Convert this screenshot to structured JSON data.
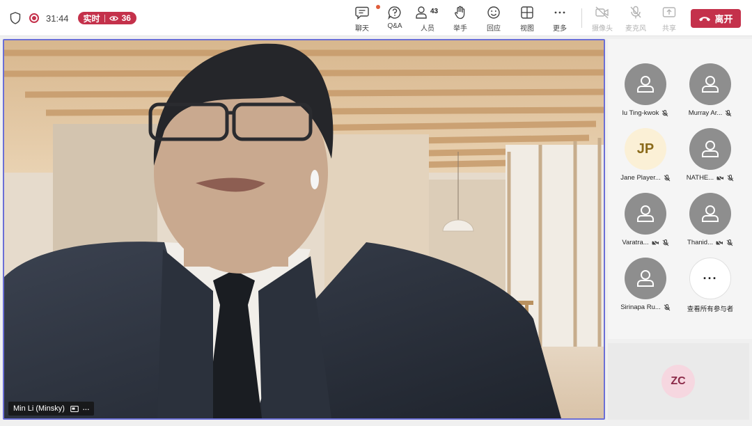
{
  "status": {
    "timer": "31:44",
    "live_label": "实时",
    "viewer_count": "36"
  },
  "toolbar": [
    {
      "id": "chat",
      "label": "聊天",
      "icon": "chat-icon"
    },
    {
      "id": "qa",
      "label": "Q&A",
      "icon": "qa-icon"
    },
    {
      "id": "people",
      "label": "人员",
      "icon": "people-icon",
      "count": "43"
    },
    {
      "id": "raise",
      "label": "举手",
      "icon": "raise-hand-icon"
    },
    {
      "id": "react",
      "label": "回应",
      "icon": "reaction-icon"
    },
    {
      "id": "view",
      "label": "视图",
      "icon": "view-grid-icon"
    },
    {
      "id": "more",
      "label": "更多",
      "icon": "more-icon"
    },
    {
      "id": "camera",
      "label": "摄像头",
      "icon": "camera-off-icon",
      "disabled": true
    },
    {
      "id": "mic",
      "label": "麦克风",
      "icon": "mic-off-icon",
      "disabled": true
    },
    {
      "id": "share",
      "label": "共享",
      "icon": "share-icon",
      "disabled": true
    }
  ],
  "leave_label": "离开",
  "presenter": {
    "name": "Min Li (Minsky)"
  },
  "participants": [
    {
      "name": "lu Ting-kwok",
      "avatar": "person",
      "cam_off": false
    },
    {
      "name": "Murray Ar...",
      "avatar": "person",
      "cam_off": false
    },
    {
      "name": "Jane Player...",
      "avatar": "JP",
      "cam_off": false
    },
    {
      "name": "NATHE...",
      "avatar": "person",
      "cam_off": true
    },
    {
      "name": "Varatra...",
      "avatar": "person",
      "cam_off": true
    },
    {
      "name": "Thanid...",
      "avatar": "person",
      "cam_off": true
    },
    {
      "name": "Sirinapa Ru...",
      "avatar": "person",
      "cam_off": false
    }
  ],
  "view_all_label": "查看所有参与者",
  "self": {
    "initials": "ZC"
  },
  "colors": {
    "accent_red": "#c4314b",
    "speaker_border": "#6b6fd6"
  }
}
